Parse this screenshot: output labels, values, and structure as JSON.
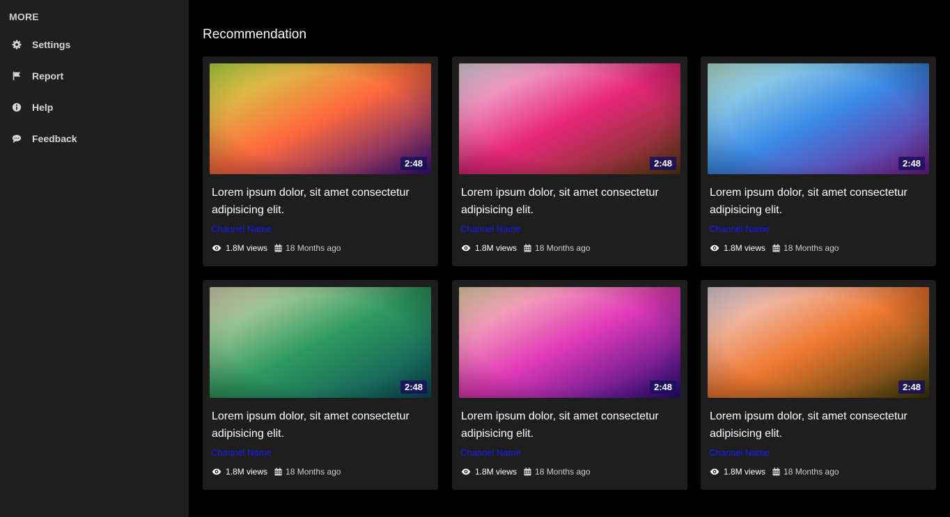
{
  "sidebar": {
    "title": "MORE",
    "items": [
      {
        "label": "Settings",
        "icon": "gear-icon"
      },
      {
        "label": "Report",
        "icon": "flag-icon"
      },
      {
        "label": "Help",
        "icon": "info-icon"
      },
      {
        "label": "Feedback",
        "icon": "comment-icon"
      }
    ]
  },
  "main": {
    "section_title": "Recommendation",
    "cards": [
      {
        "duration": "2:48",
        "title": "Lorem ipsum dolor, sit amet consectetur adipisicing elit.",
        "channel": "Channel Name",
        "views": "1.8M views",
        "date": "18 Months ago",
        "gradient": [
          "#c6f04a",
          "#ff6a3d",
          "#3a0f7a"
        ]
      },
      {
        "duration": "2:48",
        "title": "Lorem ipsum dolor, sit amet consectetur adipisicing elit.",
        "channel": "Channel Name",
        "views": "1.8M views",
        "date": "18 Months ago",
        "gradient": [
          "#f2e6f2",
          "#e8267a",
          "#5a3a10"
        ]
      },
      {
        "duration": "2:48",
        "title": "Lorem ipsum dolor, sit amet consectetur adipisicing elit.",
        "channel": "Channel Name",
        "views": "1.8M views",
        "date": "18 Months ago",
        "gradient": [
          "#c4f5e4",
          "#3a8ae8",
          "#7a1a8a"
        ]
      },
      {
        "duration": "2:48",
        "title": "Lorem ipsum dolor, sit amet consectetur adipisicing elit.",
        "channel": "Channel Name",
        "views": "1.8M views",
        "date": "18 Months ago",
        "gradient": [
          "#ece3c0",
          "#2e9a5e",
          "#0a4a5a"
        ]
      },
      {
        "duration": "2:48",
        "title": "Lorem ipsum dolor, sit amet consectetur adipisicing elit.",
        "channel": "Channel Name",
        "views": "1.8M views",
        "date": "18 Months ago",
        "gradient": [
          "#fbe6b8",
          "#e23ab8",
          "#2a0a7a"
        ]
      },
      {
        "duration": "2:48",
        "title": "Lorem ipsum dolor, sit amet consectetur adipisicing elit.",
        "channel": "Channel Name",
        "views": "1.8M views",
        "date": "18 Months ago",
        "gradient": [
          "#efe0ef",
          "#f07830",
          "#3a3a0a"
        ]
      }
    ]
  }
}
